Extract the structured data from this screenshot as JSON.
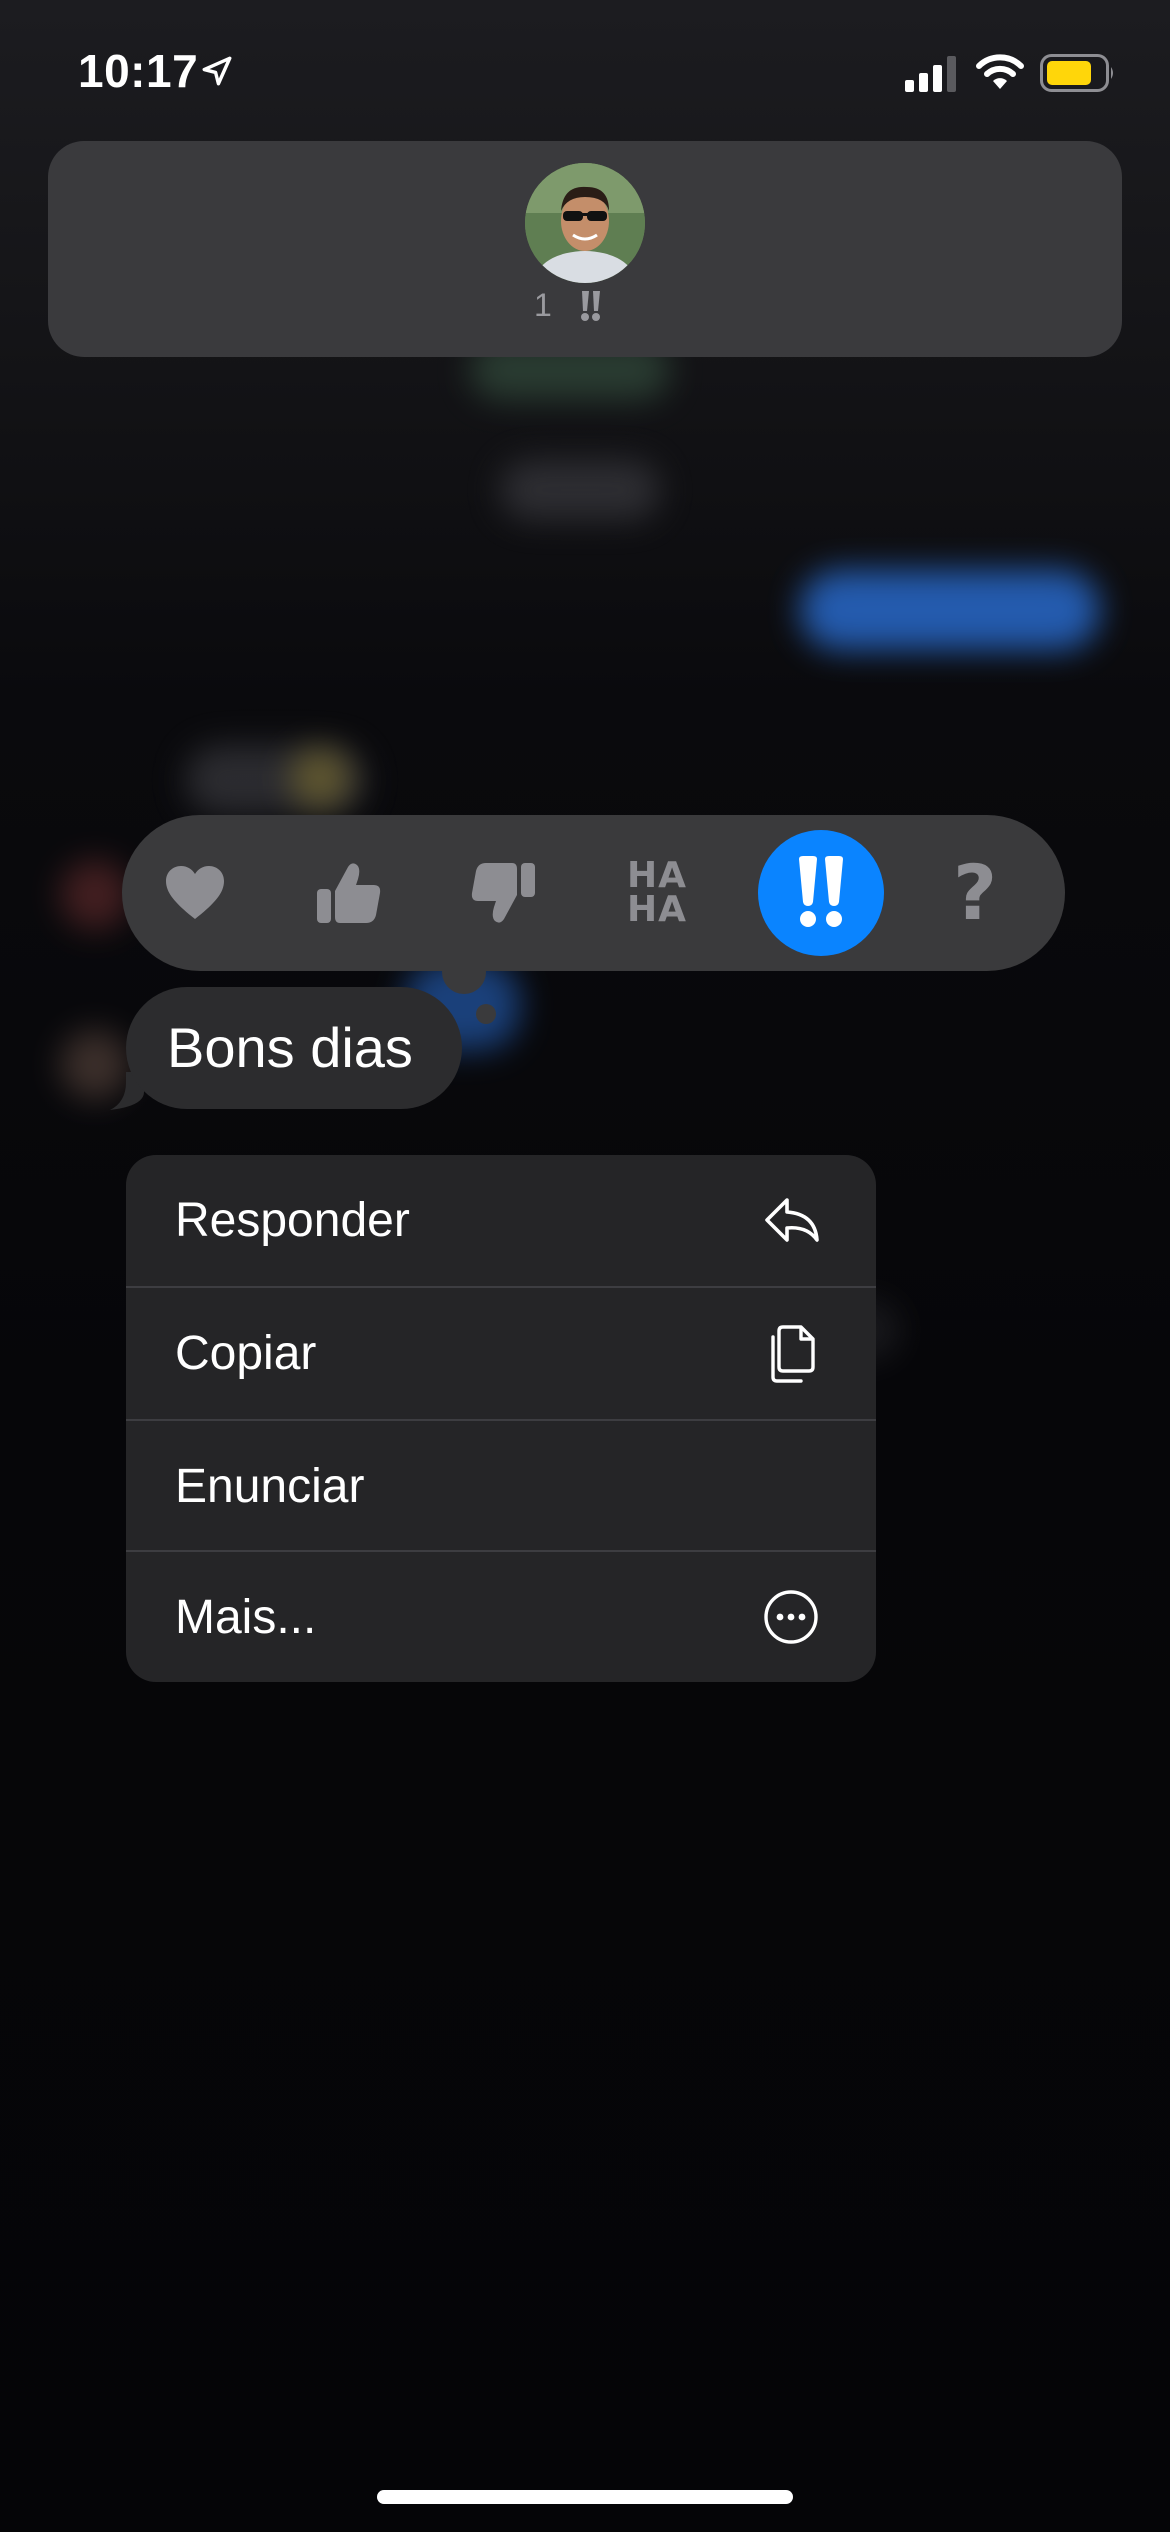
{
  "status_bar": {
    "time": "10:17",
    "location_icon": "location-arrow-icon",
    "signal_icon": "cellular-signal-icon",
    "wifi_icon": "wifi-icon",
    "battery_icon": "battery-icon",
    "battery_color": "#ffd60a"
  },
  "reaction_summary": {
    "count": "1",
    "reaction_icon": "exclamation-icon"
  },
  "tapbacks": [
    {
      "name": "heart",
      "icon": "heart-icon",
      "selected": false
    },
    {
      "name": "thumbs-up",
      "icon": "thumbs-up-icon",
      "selected": false
    },
    {
      "name": "thumbs-down",
      "icon": "thumbs-down-icon",
      "selected": false
    },
    {
      "name": "haha",
      "text": "HA HA",
      "line1": "HA",
      "line2": "HA",
      "selected": false
    },
    {
      "name": "emphasize",
      "icon": "double-exclamation-icon",
      "selected": true
    },
    {
      "name": "question",
      "text": "?",
      "selected": false
    }
  ],
  "message": {
    "text": "Bons dias"
  },
  "menu": {
    "items": [
      {
        "label": "Responder",
        "icon": "reply-arrow-icon"
      },
      {
        "label": "Copiar",
        "icon": "copy-documents-icon"
      },
      {
        "label": "Enunciar",
        "icon": ""
      },
      {
        "label": "Mais...",
        "icon": "more-ellipsis-circle-icon"
      }
    ]
  },
  "colors": {
    "accent": "#0a84ff",
    "menu_background": "#252527",
    "bubble_background": "#2c2c2e",
    "tapback_bar": "#3a3a3c",
    "inactive_icon": "#8d8d92"
  }
}
